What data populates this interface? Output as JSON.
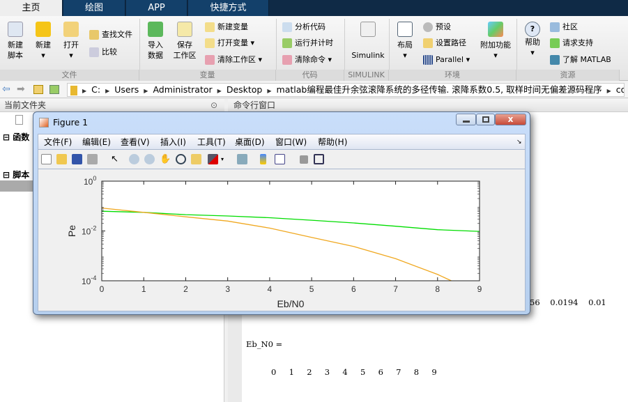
{
  "tabs": [
    "主页",
    "绘图",
    "APP",
    "快捷方式"
  ],
  "ribbon": {
    "file": {
      "new_script": "新建\n脚本",
      "new": "新建",
      "open": "打开",
      "find_files": "查找文件",
      "compare": "比较",
      "group": "文件"
    },
    "variable": {
      "import": "导入\n数据",
      "save_ws": "保存\n工作区",
      "new_var": "新建变量",
      "open_var": "打开变量",
      "clear_ws": "清除工作区",
      "group": "变量"
    },
    "code": {
      "analyze": "分析代码",
      "run_time": "运行并计时",
      "clear_cmd": "清除命令",
      "group": "代码"
    },
    "simulink": {
      "label": "Simulink",
      "group": "SIMULINK"
    },
    "env": {
      "layout": "布局",
      "prefs": "预设",
      "set_path": "设置路径",
      "parallel": "Parallel",
      "addons": "附加功能",
      "group": "环境"
    },
    "resources": {
      "help": "帮助",
      "community": "社区",
      "support": "请求支持",
      "learn": "了解 MATLAB",
      "group": "资源"
    }
  },
  "address": {
    "crumbs": [
      "C:",
      "Users",
      "Administrator",
      "Desktop",
      "matlab编程最佳升余弦滚降系统的多径传输. 滚降系数0.5, 取样时间无偏差源码程序",
      "code"
    ]
  },
  "left_panel": {
    "title": "当前文件夹",
    "sections": [
      "函数",
      "脚本"
    ]
  },
  "command_window": {
    "title": "命令行窗口",
    "partial_row": "56    0.0194    0.01",
    "var_line": "Eb_N0 =",
    "values_line": "0     1     2     3     4     5     6     7     8     9"
  },
  "figure": {
    "title": "Figure 1",
    "menu": [
      "文件(F)",
      "编辑(E)",
      "查看(V)",
      "插入(I)",
      "工具(T)",
      "桌面(D)",
      "窗口(W)",
      "帮助(H)"
    ],
    "toolbar": [
      "new-figure-icon",
      "open-icon",
      "save-icon",
      "print-icon",
      "pointer-icon",
      "zoom-in-icon",
      "zoom-out-icon",
      "pan-icon",
      "rotate-icon",
      "data-cursor-icon",
      "brush-icon",
      "link-icon",
      "colorbar-icon",
      "legend-icon",
      "hide-tools-icon",
      "dock-icon"
    ]
  },
  "chart_data": {
    "type": "line",
    "xlabel": "Eb/N0",
    "ylabel": "Pe",
    "xlim": [
      0,
      9
    ],
    "ylim": [
      0.0001,
      1
    ],
    "yscale": "log",
    "xticks": [
      "0",
      "1",
      "2",
      "3",
      "4",
      "5",
      "6",
      "7",
      "8",
      "9"
    ],
    "yticks": [
      {
        "base": "10",
        "exp": "0"
      },
      {
        "base": "10",
        "exp": "-2"
      },
      {
        "base": "10",
        "exp": "-4"
      }
    ],
    "x": [
      0,
      1,
      2,
      3,
      4,
      5,
      6,
      7,
      8,
      9
    ],
    "series": [
      {
        "color": "#00dd00",
        "values": [
          0.062,
          0.056,
          0.045,
          0.04,
          0.034,
          0.027,
          0.021,
          0.0155,
          0.0112,
          0.0096
        ]
      },
      {
        "color": "#f0a820",
        "values": [
          0.083,
          0.056,
          0.037,
          0.025,
          0.013,
          0.0055,
          0.0024,
          0.00077,
          0.00018,
          3e-05
        ]
      }
    ]
  }
}
